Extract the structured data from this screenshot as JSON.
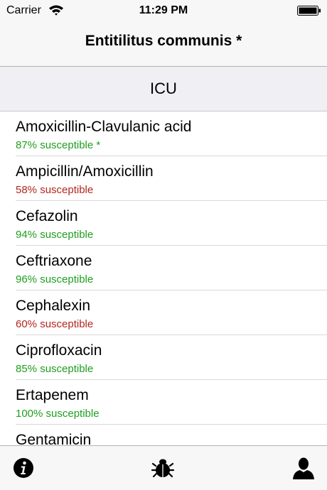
{
  "status_bar": {
    "carrier": "Carrier",
    "time": "11:29 PM",
    "icons": [
      "wifi-icon",
      "battery-icon"
    ]
  },
  "nav": {
    "title": "Entitilitus communis *"
  },
  "section": {
    "title": "ICU"
  },
  "colors": {
    "good": "#1f9e1f",
    "bad": "#b3261e"
  },
  "drugs": [
    {
      "name": "Amoxicillin-Clavulanic acid",
      "susceptibility": "87% susceptible *",
      "status": "good"
    },
    {
      "name": "Ampicillin/Amoxicillin",
      "susceptibility": "58% susceptible",
      "status": "bad"
    },
    {
      "name": "Cefazolin",
      "susceptibility": "94% susceptible",
      "status": "good"
    },
    {
      "name": "Ceftriaxone",
      "susceptibility": "96% susceptible",
      "status": "good"
    },
    {
      "name": "Cephalexin",
      "susceptibility": "60% susceptible",
      "status": "bad"
    },
    {
      "name": "Ciprofloxacin",
      "susceptibility": "85% susceptible",
      "status": "good"
    },
    {
      "name": "Ertapenem",
      "susceptibility": "100% susceptible",
      "status": "good"
    },
    {
      "name": "Gentamicin",
      "susceptibility": "",
      "status": "good"
    }
  ],
  "tab_bar": {
    "icons": [
      "info-icon",
      "bug-icon",
      "person-icon"
    ]
  }
}
